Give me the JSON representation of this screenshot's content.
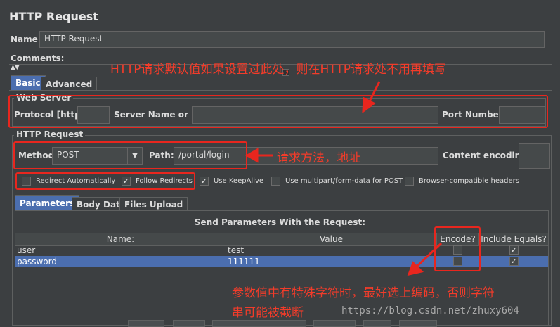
{
  "window": {
    "title": "HTTP Request"
  },
  "name_field": {
    "label": "Name:",
    "value": "HTTP Request"
  },
  "comments": {
    "label": "Comments:"
  },
  "collapse_glyph": "▲▼",
  "main_tabs": [
    {
      "label": "Basic"
    },
    {
      "label": "Advanced"
    }
  ],
  "web_server": {
    "group_title": "Web Server",
    "protocol_label": "Protocol [http]:",
    "protocol_value": "",
    "server_label": "Server Name or IP:",
    "server_value": "",
    "port_label": "Port Number:",
    "port_value": ""
  },
  "http_request": {
    "group_title": "HTTP Request",
    "method_label": "Method:",
    "method_value": "POST",
    "path_label": "Path:",
    "path_value": "/portal/login",
    "encoding_label": "Content encoding:",
    "encoding_value": ""
  },
  "options": [
    {
      "label": "Redirect Automatically",
      "checked": false
    },
    {
      "label": "Follow Redirects",
      "checked": true
    },
    {
      "label": "Use KeepAlive",
      "checked": true
    },
    {
      "label": "Use multipart/form-data for POST",
      "checked": false
    },
    {
      "label": "Browser-compatible headers",
      "checked": false
    }
  ],
  "param_tabs": [
    {
      "label": "Parameters"
    },
    {
      "label": "Body Data"
    },
    {
      "label": "Files Upload"
    }
  ],
  "params_table": {
    "caption": "Send Parameters With the Request:",
    "columns": [
      "Name:",
      "Value",
      "Encode?",
      "Include Equals?"
    ],
    "rows": [
      {
        "name": "user",
        "value": "test",
        "encode": false,
        "include_equals": true
      },
      {
        "name": "password",
        "value": "111111",
        "encode": false,
        "include_equals": true
      }
    ]
  },
  "annotations": {
    "top": "HTTP请求默认值如果设置过此处，则在HTTP请求处不用再填写",
    "method": "请求方法，地址",
    "encode_line1": "参数值中有特殊字符时，最好选上编码，否则字符",
    "encode_line2": "串可能被截断"
  },
  "watermark": "https://blog.csdn.net/zhuxy604",
  "colors": {
    "background": "#3c3f41",
    "selection": "#4b6eaf",
    "annotation": "#e8261e"
  },
  "icons": {
    "check": "✓",
    "dropdown": "▼"
  }
}
